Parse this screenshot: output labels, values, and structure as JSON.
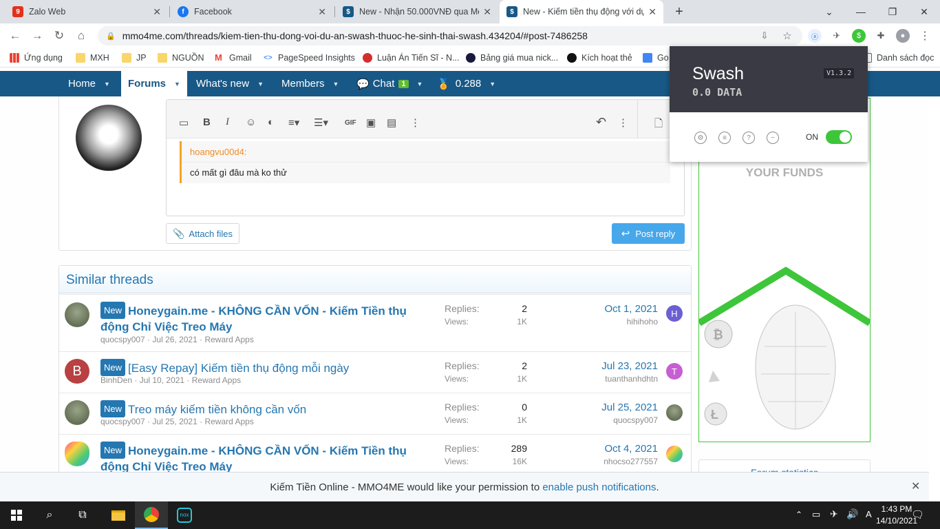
{
  "tabs": [
    {
      "title": "Zalo Web",
      "favicon": "zalo-icon"
    },
    {
      "title": "Facebook",
      "favicon": "facebook-icon"
    },
    {
      "title": "New - Nhận 50.000VNĐ qua Mo",
      "favicon": "mmo4me-icon"
    },
    {
      "title": "New - Kiếm tiền thụ động với dự",
      "favicon": "mmo4me-icon"
    }
  ],
  "address_bar": {
    "url": "mmo4me.com/threads/kiem-tien-thu-dong-voi-du-an-swash-thuoc-he-sinh-thai-swash.434204/#post-7486258"
  },
  "bookmarks": [
    {
      "label": "Ứng dụng"
    },
    {
      "label": "MXH"
    },
    {
      "label": "JP"
    },
    {
      "label": "NGUỒN"
    },
    {
      "label": "Gmail"
    },
    {
      "label": "PageSpeed Insights"
    },
    {
      "label": "Luận Án Tiến Sĩ - N..."
    },
    {
      "label": "Bảng giá mua nick..."
    },
    {
      "label": "Kích hoạt thẻ"
    },
    {
      "label": "Go"
    },
    {
      "label": "Danh sách đọc"
    }
  ],
  "site_nav": {
    "home": "Home",
    "forums": "Forums",
    "whats_new": "What's new",
    "members": "Members",
    "chat": "Chat",
    "chat_badge": "1",
    "points": "0.288"
  },
  "editor": {
    "quote_author": "hoangvu00d4:",
    "quote_text": "có mất gì đâu mà ko thử",
    "attach_label": "Attach files",
    "post_label": "Post reply"
  },
  "similar": {
    "heading": "Similar threads",
    "replies_label": "Replies:",
    "views_label": "Views:",
    "prefix": "New",
    "threads": [
      {
        "title": "Honeygain.me - KHÔNG CẦN VỐN - Kiếm Tiền thụ động Chỉ Việc Treo Máy",
        "author": "quocspy007",
        "date": "Jul 26, 2021",
        "forum": "Reward Apps",
        "replies": "2",
        "views": "1K",
        "last_date": "Oct 1, 2021",
        "last_user": "hihihoho",
        "last_initial": "H"
      },
      {
        "title": "[Easy Repay] Kiếm tiền thụ động mỗi ngày",
        "author": "BinhDen",
        "date": "Jul 10, 2021",
        "forum": "Reward Apps",
        "replies": "2",
        "views": "1K",
        "last_date": "Jul 23, 2021",
        "last_user": "tuanthanhdhtn",
        "last_initial": "T",
        "avatar_initial": "B"
      },
      {
        "title": "Treo máy kiếm tiền không cần vốn",
        "author": "quocspy007",
        "date": "Jul 25, 2021",
        "forum": "Reward Apps",
        "replies": "0",
        "views": "1K",
        "last_date": "Jul 25, 2021",
        "last_user": "quocspy007"
      },
      {
        "title": "Honeygain.me - KHÔNG CẦN VỐN - Kiếm Tiền thụ động Chỉ Việc Treo Máy",
        "replies": "289",
        "views": "16K",
        "last_date": "Oct 4, 2021",
        "last_user": "nhocso277557"
      }
    ]
  },
  "sidebar_ad": {
    "tagline": "YOUR FUNDS"
  },
  "sidebar_box": {
    "title": "Forum statistics"
  },
  "swash": {
    "name": "Swash",
    "version": "V1.3.2",
    "balance": "0.0 DATA",
    "toggle_label": "ON",
    "toggle_on": true,
    "accent": "#3ec63a"
  },
  "notification": {
    "text": "Kiếm Tiền Online - MMO4ME would like your permission to ",
    "link": "enable push notifications",
    "suffix": "."
  },
  "taskbar": {
    "time": "1:43 PM",
    "date": "14/10/2021"
  }
}
